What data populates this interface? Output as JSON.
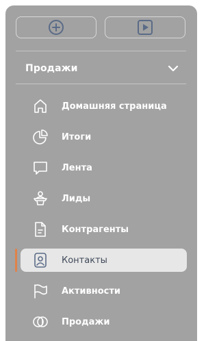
{
  "toolbar": {
    "add_icon": "plus-circle-icon",
    "run_icon": "play-square-icon"
  },
  "section": {
    "title": "Продажи",
    "expanded": true,
    "toggle_icon": "chevron-down-icon"
  },
  "menu": {
    "items": [
      {
        "label": "Домашняя страница",
        "icon": "home-icon",
        "active": false
      },
      {
        "label": "Итоги",
        "icon": "pie-chart-icon",
        "active": false
      },
      {
        "label": "Лента",
        "icon": "chat-icon",
        "active": false
      },
      {
        "label": "Лиды",
        "icon": "lead-person-icon",
        "active": false
      },
      {
        "label": "Контрагенты",
        "icon": "document-icon",
        "active": false
      },
      {
        "label": "Контакты",
        "icon": "contact-card-icon",
        "active": true
      },
      {
        "label": "Активности",
        "icon": "flag-icon",
        "active": false
      },
      {
        "label": "Продажи",
        "icon": "coins-icon",
        "active": false
      }
    ]
  },
  "colors": {
    "panel_bg": "#a2a2a2",
    "active_bg": "#e7e7e7",
    "active_marker": "#e0824a",
    "icon_blue": "#5a6b87"
  }
}
